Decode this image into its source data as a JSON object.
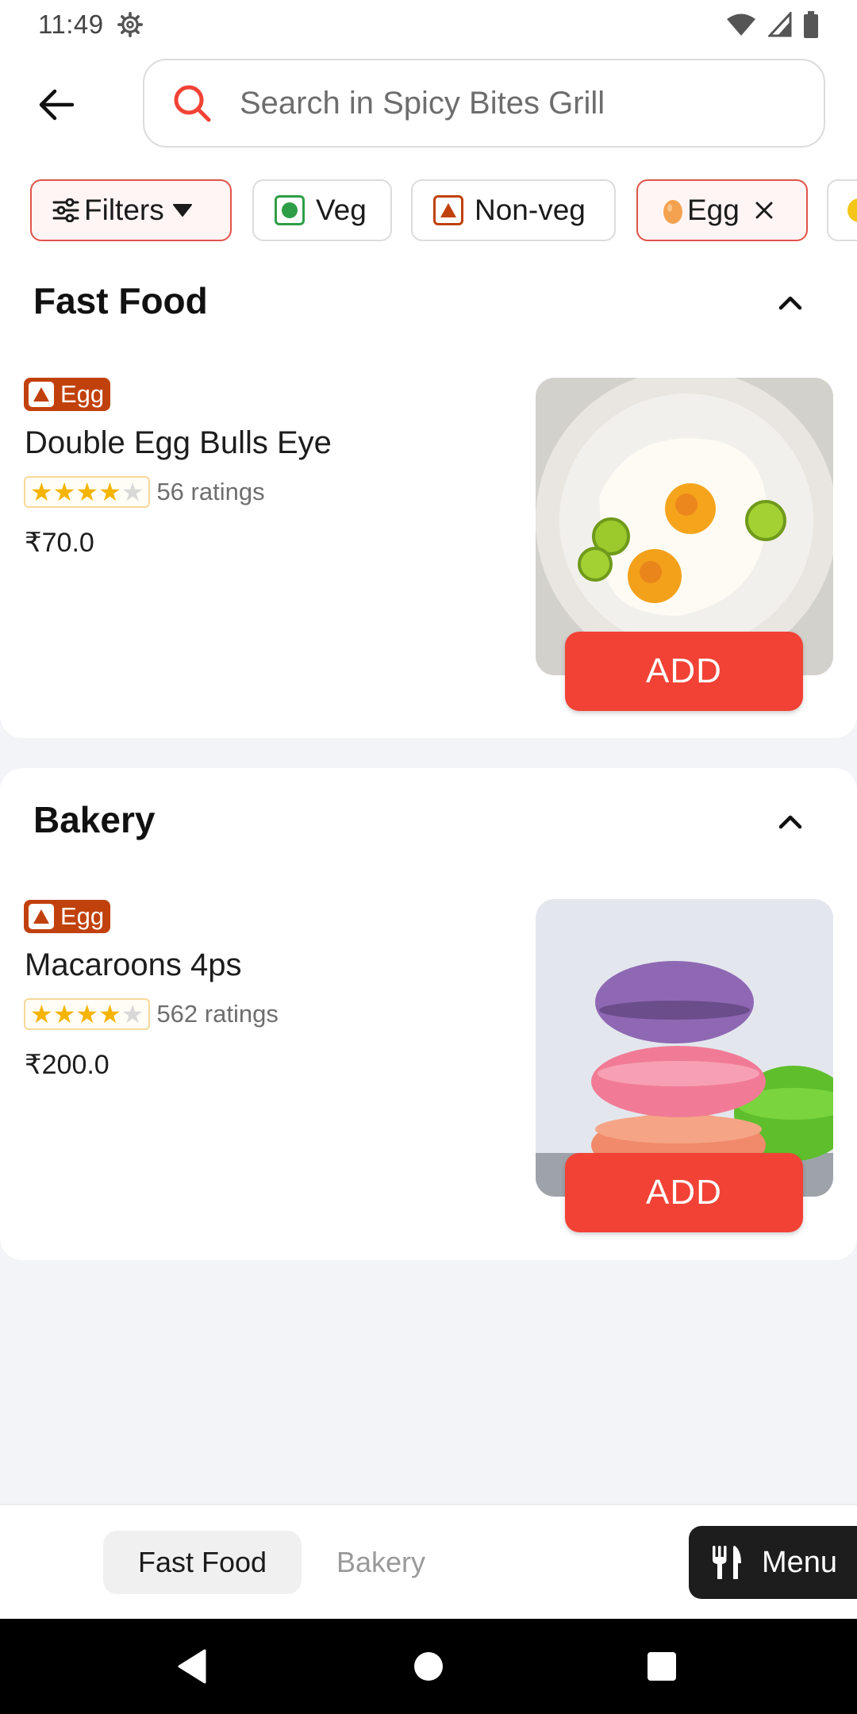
{
  "status_bar": {
    "time": "11:49"
  },
  "search": {
    "placeholder": "Search in Spicy Bites Grill"
  },
  "filter_chips": [
    {
      "label": "Filters"
    },
    {
      "label": "Veg"
    },
    {
      "label": "Non-veg"
    },
    {
      "label": "Egg",
      "active": true
    }
  ],
  "sections": [
    {
      "title": "Fast Food",
      "items": [
        {
          "badge": "Egg",
          "name": "Double Egg Bulls Eye",
          "rating_stars": 4,
          "ratings": "56 ratings",
          "price": "₹70.0",
          "add_label": "ADD"
        }
      ]
    },
    {
      "title": "Bakery",
      "items": [
        {
          "badge": "Egg",
          "name": "Macaroons 4ps",
          "rating_stars": 4,
          "ratings": "562 ratings",
          "price": "₹200.0",
          "add_label": "ADD"
        }
      ]
    }
  ],
  "bottom_tabs": [
    {
      "label": "Fast Food",
      "active": true
    },
    {
      "label": "Bakery",
      "active": false
    }
  ],
  "menu_button": {
    "label": "Menu"
  },
  "colors": {
    "accent": "#f24236",
    "egg": "#c1410c",
    "veg": "#2e9e46",
    "star": "#f5b400"
  }
}
